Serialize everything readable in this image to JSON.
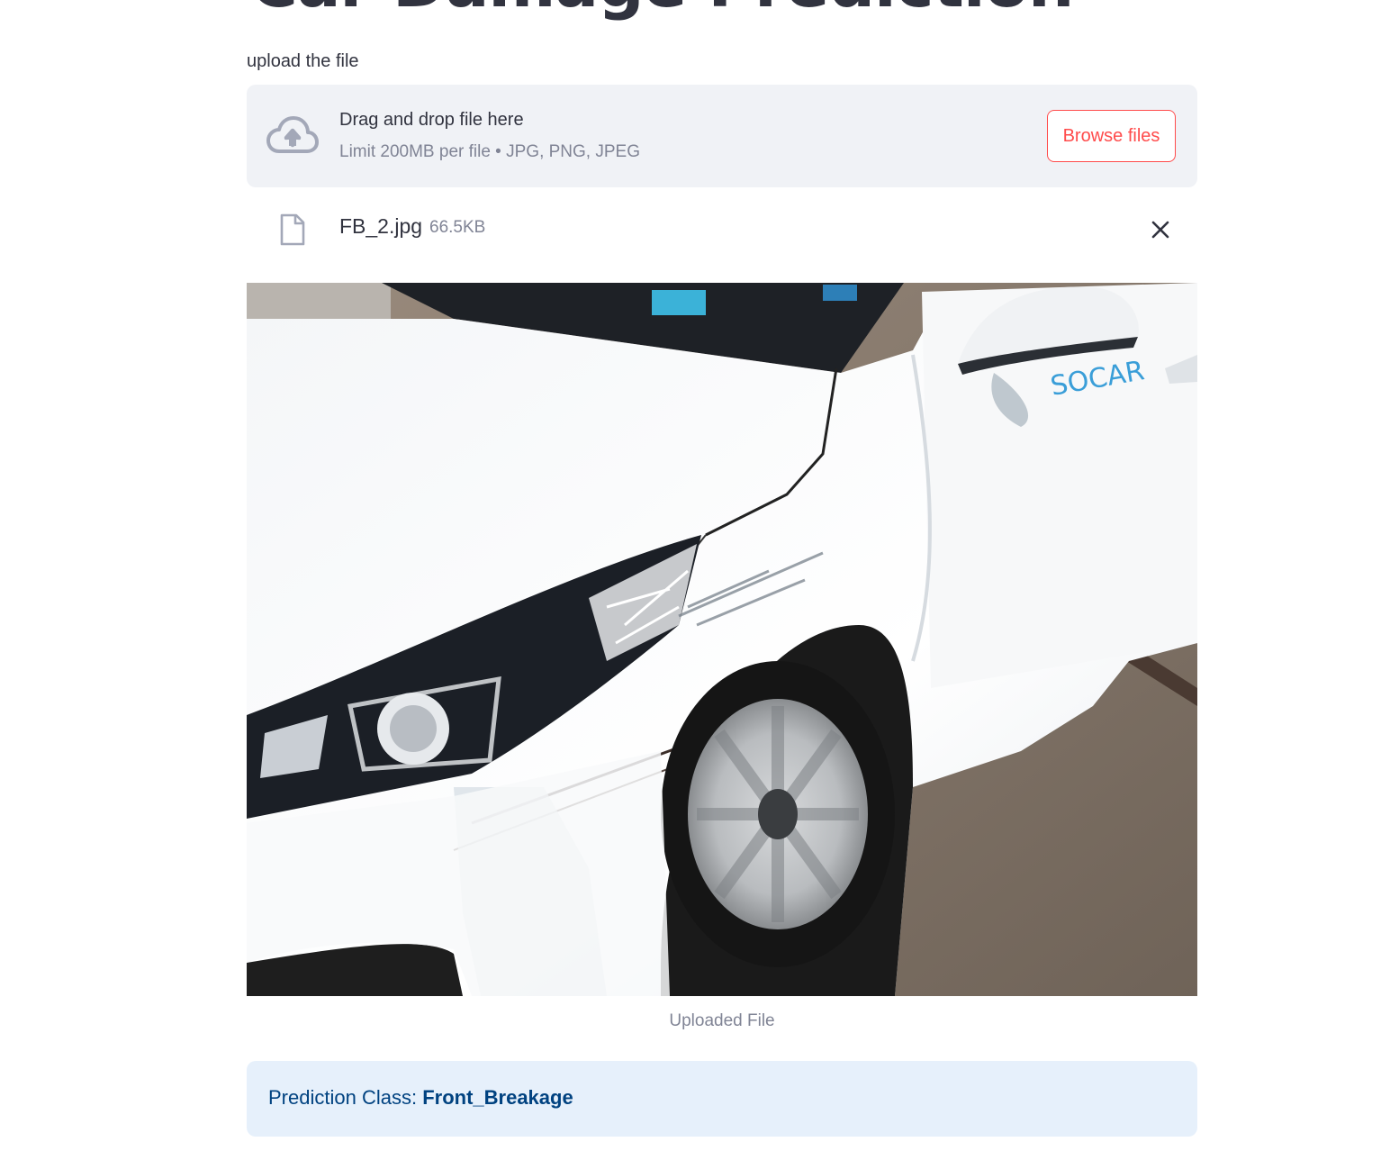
{
  "page": {
    "title": "Car Damage Prediction"
  },
  "uploader": {
    "label": "upload the file",
    "dropzone_title": "Drag and drop file here",
    "dropzone_hint": "Limit 200MB per file • JPG, PNG, JPEG",
    "browse_label": "Browse files",
    "icon": "cloud-upload-icon"
  },
  "file": {
    "name": "FB_2.jpg",
    "size": "66.5KB",
    "icon": "file-icon",
    "remove_icon": "close-icon"
  },
  "image": {
    "caption": "Uploaded File",
    "watermark": "SOCAR"
  },
  "prediction": {
    "label": "Prediction Class:",
    "value": "Front_Breakage"
  },
  "colors": {
    "accent": "#ff4b4b",
    "dropzone_bg": "#f0f2f6",
    "info_bg": "#e6f0fb",
    "info_text": "#004280",
    "muted": "#808495",
    "text": "#31333f"
  }
}
